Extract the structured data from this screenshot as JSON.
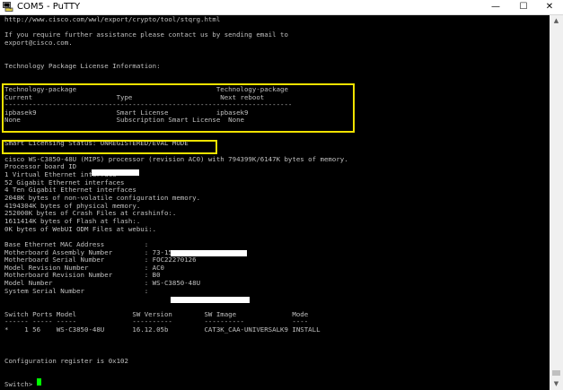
{
  "window": {
    "title": "COM5 - PuTTY",
    "min_glyph": "—",
    "max_glyph": "☐",
    "close_glyph": "✕"
  },
  "terminal": {
    "lines": [
      "http://www.cisco.com/wwl/export/crypto/tool/stqrg.html",
      "",
      "If you require further assistance please contact us by sending email to",
      "export@cisco.com.",
      "",
      "",
      "Technology Package License Information:",
      "",
      "",
      "Technology-package                                   Technology-package",
      "Current                     Type                      Next reboot",
      "------------------------------------------------------------------------",
      "ipbasek9                    Smart License            ipbasek9",
      "None                        Subscription Smart License  None",
      "",
      "",
      "Smart Licensing Status: UNREGISTERED/EVAL MODE",
      "",
      "cisco WS-C3850-48U (MIPS) processor (revision AC0) with 794399K/6147K bytes of memory.",
      "Processor board ID",
      "1 Virtual Ethernet interface",
      "52 Gigabit Ethernet interfaces",
      "4 Ten Gigabit Ethernet interfaces",
      "2048K bytes of non-volatile configuration memory.",
      "4194304K bytes of physical memory.",
      "252000K bytes of Crash Files at crashinfo:.",
      "1611414K bytes of Flash at flash:.",
      "0K bytes of WebUI ODM Files at webui:.",
      "",
      "Base Ethernet MAC Address          :",
      "Motherboard Assembly Number        : 73-15799-08",
      "Motherboard Serial Number          : FOC22270126",
      "Model Revision Number              : AC0",
      "Motherboard Revision Number        : B0",
      "Model Number                       : WS-C3850-48U",
      "System Serial Number               :",
      "",
      "",
      "Switch Ports Model              SW Version        SW Image              Mode",
      "------ ----- -----              ----------        ----------            ----",
      "*    1 56    WS-C3850-48U       16.12.05b         CAT3K_CAA-UNIVERSALK9 INSTALL",
      "",
      "",
      "",
      "Configuration register is 0x102",
      "",
      "",
      "Switch>"
    ]
  }
}
